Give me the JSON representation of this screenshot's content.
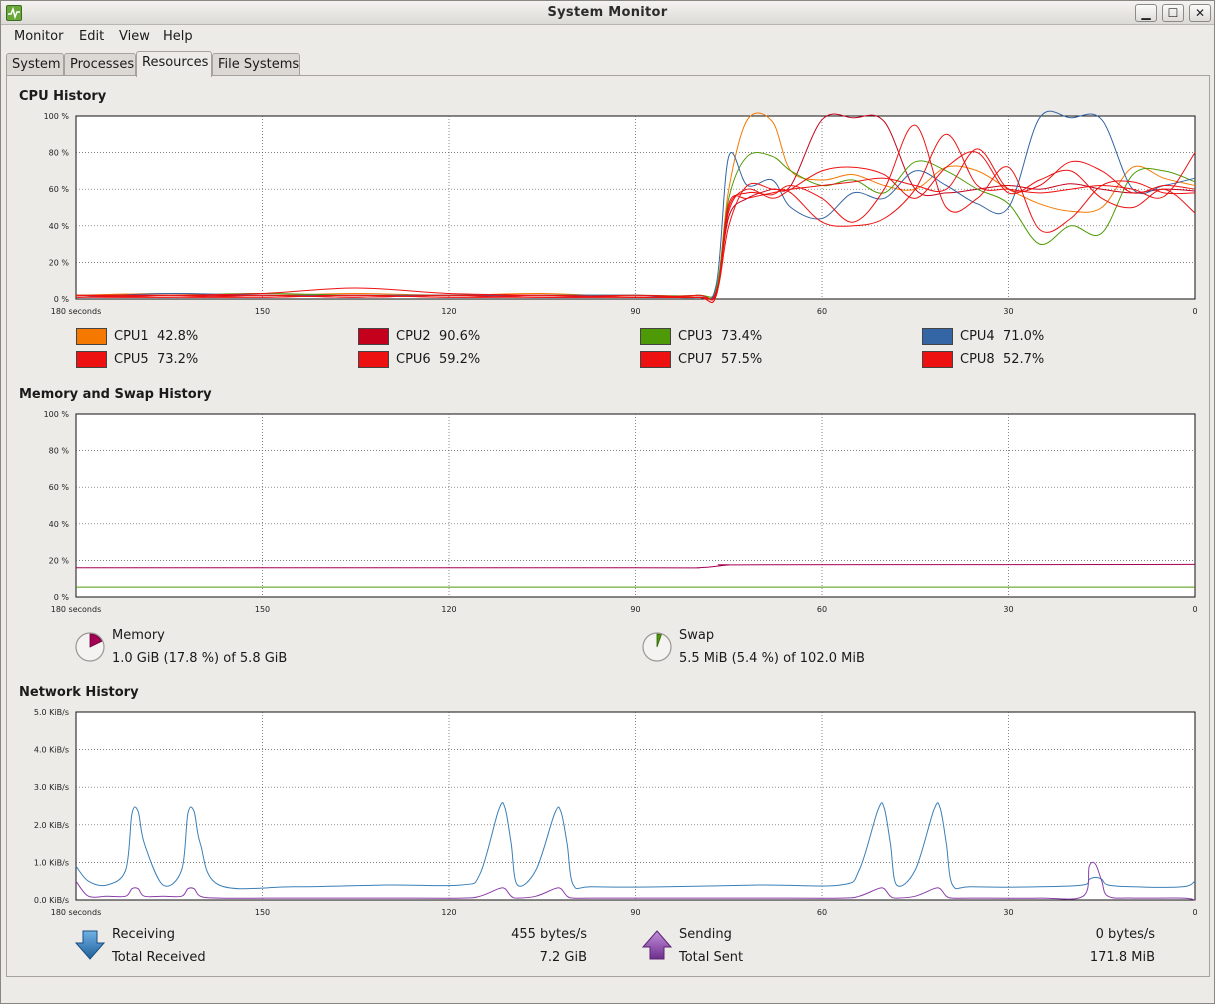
{
  "window": {
    "title": "System Monitor"
  },
  "menu": [
    "Monitor",
    "Edit",
    "View",
    "Help"
  ],
  "tabs": [
    {
      "label": "System",
      "active": false
    },
    {
      "label": "Processes",
      "active": false
    },
    {
      "label": "Resources",
      "active": true
    },
    {
      "label": "File Systems",
      "active": false
    }
  ],
  "cpu": {
    "title": "CPU History",
    "y_ticks": [
      "100 %",
      "80 %",
      "60 %",
      "40 %",
      "20 %",
      "0 %"
    ],
    "x_ticks": [
      "180 seconds",
      "150",
      "120",
      "90",
      "60",
      "30",
      "0"
    ],
    "legend": [
      {
        "name": "CPU1",
        "value": "42.8%",
        "color": "#f57900"
      },
      {
        "name": "CPU2",
        "value": "90.6%",
        "color": "#c4001d"
      },
      {
        "name": "CPU3",
        "value": "73.4%",
        "color": "#4e9a06"
      },
      {
        "name": "CPU4",
        "value": "71.0%",
        "color": "#3465a4"
      },
      {
        "name": "CPU5",
        "value": "73.2%",
        "color": "#ee1111"
      },
      {
        "name": "CPU6",
        "value": "59.2%",
        "color": "#ee1111"
      },
      {
        "name": "CPU7",
        "value": "57.5%",
        "color": "#ee1111"
      },
      {
        "name": "CPU8",
        "value": "52.7%",
        "color": "#ee1111"
      }
    ]
  },
  "memory": {
    "title": "Memory and Swap History",
    "y_ticks": [
      "100 %",
      "80 %",
      "60 %",
      "40 %",
      "20 %",
      "0 %"
    ],
    "x_ticks": [
      "180 seconds",
      "150",
      "120",
      "90",
      "60",
      "30",
      "0"
    ],
    "memory_label": "Memory",
    "memory_value": "1.0 GiB (17.8 %) of 5.8 GiB",
    "memory_fraction": 0.178,
    "memory_color": "#a40054",
    "swap_label": "Swap",
    "swap_value": "5.5 MiB (5.4 %) of 102.0 MiB",
    "swap_fraction": 0.054,
    "swap_color": "#4e9a06"
  },
  "network": {
    "title": "Network History",
    "y_ticks": [
      "5.0 KiB/s",
      "4.0 KiB/s",
      "3.0 KiB/s",
      "2.0 KiB/s",
      "1.0 KiB/s",
      "0.0 KiB/s"
    ],
    "x_ticks": [
      "180 seconds",
      "150",
      "120",
      "90",
      "60",
      "30",
      "0"
    ],
    "receiving_label": "Receiving",
    "receiving_value": "455 bytes/s",
    "total_received_label": "Total Received",
    "total_received_value": "7.2 GiB",
    "receiving_color": "#3a7fb6",
    "sending_label": "Sending",
    "sending_value": "0 bytes/s",
    "total_sent_label": "Total Sent",
    "total_sent_value": "171.8 MiB",
    "sending_color": "#8a3fa8"
  },
  "chart_data": [
    {
      "type": "line",
      "title": "CPU History",
      "x": [
        180,
        165,
        150,
        135,
        120,
        105,
        90,
        80,
        77,
        75,
        72,
        68,
        65,
        60,
        55,
        50,
        45,
        40,
        35,
        30,
        25,
        20,
        15,
        10,
        5,
        0
      ],
      "ylim": [
        0,
        100
      ],
      "xlim": [
        180,
        0
      ],
      "grid": true,
      "series": [
        {
          "name": "CPU1",
          "color": "#f57900",
          "values": [
            2,
            3,
            2,
            3,
            2,
            3,
            1,
            2,
            5,
            60,
            98,
            97,
            70,
            65,
            68,
            62,
            60,
            72,
            70,
            60,
            52,
            48,
            50,
            72,
            66,
            62
          ]
        },
        {
          "name": "CPU2",
          "color": "#c4001d",
          "values": [
            1,
            2,
            2,
            1,
            2,
            1,
            1,
            1,
            4,
            45,
            55,
            60,
            62,
            98,
            99,
            97,
            60,
            58,
            60,
            62,
            60,
            63,
            60,
            58,
            60,
            59
          ]
        },
        {
          "name": "CPU3",
          "color": "#4e9a06",
          "values": [
            2,
            2,
            3,
            2,
            2,
            2,
            2,
            2,
            6,
            55,
            78,
            78,
            70,
            62,
            65,
            58,
            75,
            70,
            60,
            52,
            30,
            40,
            36,
            68,
            70,
            64
          ]
        },
        {
          "name": "CPU4",
          "color": "#3465a4",
          "values": [
            1,
            3,
            2,
            2,
            2,
            2,
            2,
            1,
            8,
            78,
            62,
            65,
            50,
            44,
            58,
            55,
            70,
            62,
            52,
            50,
            99,
            99,
            98,
            60,
            62,
            66
          ]
        },
        {
          "name": "CPU5",
          "color": "#ee1111",
          "values": [
            1,
            2,
            3,
            6,
            3,
            2,
            1,
            1,
            3,
            40,
            62,
            60,
            58,
            42,
            40,
            44,
            60,
            90,
            62,
            60,
            58,
            60,
            62,
            60,
            56,
            80
          ]
        },
        {
          "name": "CPU6",
          "color": "#ee1111",
          "values": [
            2,
            2,
            1,
            2,
            1,
            2,
            1,
            2,
            3,
            48,
            60,
            55,
            60,
            70,
            72,
            68,
            55,
            72,
            80,
            58,
            65,
            70,
            55,
            50,
            60,
            47
          ]
        },
        {
          "name": "CPU7",
          "color": "#ee1111",
          "values": [
            1,
            1,
            2,
            1,
            2,
            1,
            2,
            1,
            2,
            50,
            58,
            57,
            62,
            55,
            42,
            60,
            95,
            50,
            55,
            72,
            38,
            44,
            62,
            64,
            58,
            58
          ]
        },
        {
          "name": "CPU8",
          "color": "#ee1111",
          "values": [
            2,
            1,
            1,
            2,
            1,
            1,
            1,
            1,
            2,
            52,
            55,
            58,
            60,
            62,
            64,
            66,
            62,
            60,
            82,
            60,
            62,
            75,
            70,
            58,
            62,
            60
          ]
        }
      ]
    },
    {
      "type": "line",
      "title": "Memory and Swap History",
      "x": [
        180,
        90,
        80,
        75,
        70,
        0
      ],
      "ylim": [
        0,
        100
      ],
      "xlim": [
        180,
        0
      ],
      "grid": true,
      "series": [
        {
          "name": "Memory",
          "color": "#a40054",
          "values": [
            16,
            16,
            16,
            17.5,
            17.6,
            17.8
          ]
        },
        {
          "name": "Swap",
          "color": "#4e9a06",
          "values": [
            5.4,
            5.4,
            5.4,
            5.4,
            5.4,
            5.4
          ]
        }
      ]
    },
    {
      "type": "line",
      "title": "Network History",
      "x": [
        180,
        178,
        175,
        172,
        171,
        170,
        169,
        166,
        163,
        162,
        161,
        160,
        157,
        145,
        130,
        118,
        115,
        112,
        111,
        110,
        109,
        106,
        103,
        102,
        101,
        100,
        97,
        85,
        70,
        57,
        54,
        51,
        50,
        49,
        48,
        45,
        42,
        41,
        40,
        39,
        36,
        25,
        18,
        17,
        16,
        15,
        14,
        10,
        2,
        0
      ],
      "ylim": [
        0,
        5
      ],
      "xlim": [
        180,
        0
      ],
      "grid": true,
      "series": [
        {
          "name": "Receiving",
          "color": "#3a7fb6",
          "values": [
            0.9,
            0.5,
            0.4,
            0.8,
            2.3,
            2.35,
            1.5,
            0.4,
            0.8,
            2.3,
            2.35,
            1.5,
            0.4,
            0.35,
            0.4,
            0.4,
            0.7,
            2.4,
            2.45,
            1.5,
            0.4,
            0.8,
            2.3,
            2.35,
            1.5,
            0.4,
            0.35,
            0.35,
            0.4,
            0.4,
            0.8,
            2.4,
            2.45,
            1.5,
            0.4,
            0.8,
            2.4,
            2.45,
            1.5,
            0.4,
            0.35,
            0.35,
            0.4,
            0.55,
            0.6,
            0.55,
            0.4,
            0.35,
            0.35,
            0.5
          ]
        },
        {
          "name": "Sending",
          "color": "#8a3fa8",
          "values": [
            0.5,
            0.1,
            0.1,
            0.1,
            0.3,
            0.3,
            0.1,
            0.1,
            0.1,
            0.3,
            0.3,
            0.1,
            0.05,
            0.05,
            0.05,
            0.05,
            0.1,
            0.3,
            0.3,
            0.1,
            0.05,
            0.1,
            0.3,
            0.3,
            0.1,
            0.05,
            0.05,
            0.05,
            0.05,
            0.05,
            0.1,
            0.3,
            0.3,
            0.1,
            0.05,
            0.1,
            0.3,
            0.3,
            0.1,
            0.05,
            0.05,
            0.05,
            0.1,
            0.9,
            0.95,
            0.5,
            0.1,
            0.05,
            0.05,
            0.0
          ]
        }
      ]
    }
  ]
}
